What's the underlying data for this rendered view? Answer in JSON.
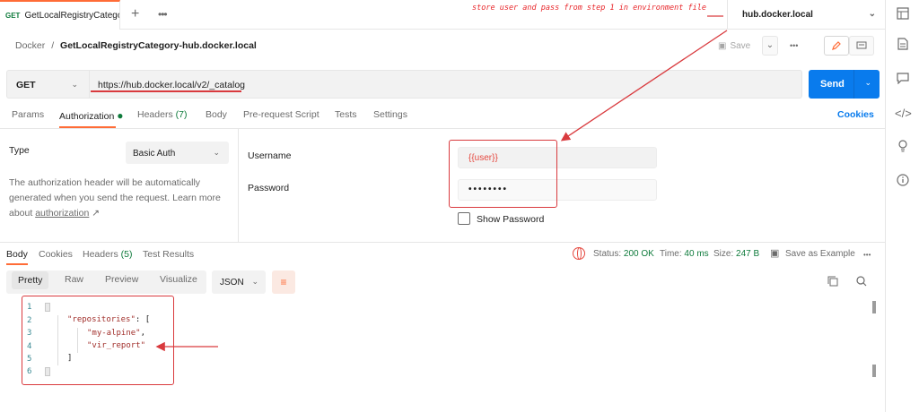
{
  "tab": {
    "method": "GET",
    "name": "GetLocalRegistryCategory"
  },
  "environment": {
    "name": "hub.docker.local"
  },
  "annotation_note": "store user and pass from step 1 in environment file",
  "breadcrumb": {
    "collection": "Docker",
    "separator": "/",
    "request": "GetLocalRegistryCategory-hub.docker.local"
  },
  "toolbar": {
    "save_label": "Save"
  },
  "request": {
    "method": "GET",
    "url": "https://hub.docker.local/v2/_catalog",
    "send_label": "Send"
  },
  "request_tabs": [
    {
      "label": "Params"
    },
    {
      "label": "Authorization",
      "active": true
    },
    {
      "label": "Headers",
      "count": "(7)"
    },
    {
      "label": "Body"
    },
    {
      "label": "Pre-request Script"
    },
    {
      "label": "Tests"
    },
    {
      "label": "Settings"
    }
  ],
  "cookies_link": "Cookies",
  "auth": {
    "type_label": "Type",
    "type_value": "Basic Auth",
    "help_text": "The authorization header will be automatically generated when you send the request. Learn more about",
    "help_link": "authorization",
    "help_arrow": "↗",
    "username_label": "Username",
    "username_value": "{{user}}",
    "password_label": "Password",
    "password_value": "••••••••",
    "show_password_label": "Show Password"
  },
  "response_tabs": [
    {
      "label": "Body",
      "active": true
    },
    {
      "label": "Cookies"
    },
    {
      "label": "Headers",
      "count": "(5)"
    },
    {
      "label": "Test Results"
    }
  ],
  "response_status": {
    "status_label": "Status:",
    "status_value": "200 OK",
    "time_label": "Time:",
    "time_value": "40 ms",
    "size_label": "Size:",
    "size_value": "247 B",
    "save_example": "Save as Example"
  },
  "view_modes": [
    "Pretty",
    "Raw",
    "Preview",
    "Visualize"
  ],
  "format": "JSON",
  "code_lines": [
    "1",
    "2",
    "3",
    "4",
    "5",
    "6"
  ],
  "code": {
    "key": "\"repositories\"",
    "colon_bracket": ": [",
    "item1": "\"my-alpine\"",
    "item2": "\"vir_report\"",
    "close": "]"
  },
  "colors": {
    "accent": "#ff6c37",
    "send": "#097bed",
    "annotation": "#d93a3e",
    "success": "#0f7b3c"
  }
}
